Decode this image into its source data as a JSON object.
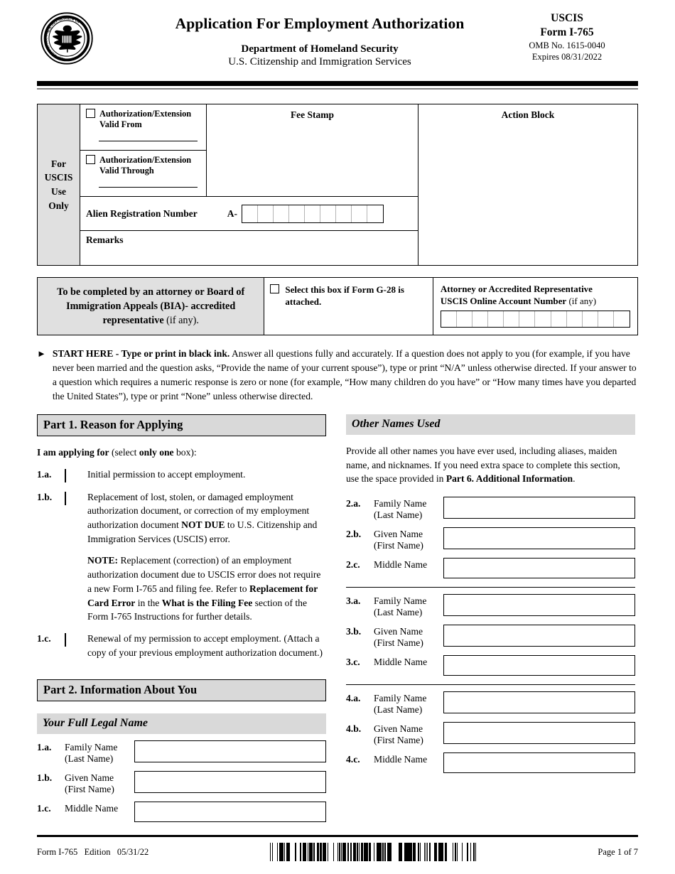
{
  "header": {
    "seal_icon": "dhs-seal-icon",
    "title": "Application For Employment Authorization",
    "department": "Department of Homeland Security",
    "agency": "U.S. Citizenship and Immigration Services",
    "agency_short": "USCIS",
    "form_number": "Form I-765",
    "omb": "OMB No. 1615-0040",
    "expires": "Expires 08/31/2022"
  },
  "uscis_use_only": {
    "side_label": "For\nUSCIS\nUse\nOnly",
    "valid_from_label": "Authorization/Extension\nValid From",
    "valid_through_label": "Authorization/Extension\nValid Through",
    "fee_stamp_label": "Fee Stamp",
    "action_block_label": "Action Block",
    "alien_registration_label": "Alien Registration Number",
    "alien_prefix": "A-",
    "alien_cells": 9,
    "remarks_label": "Remarks"
  },
  "attorney_block": {
    "description_bold": "To be completed by an attorney or Board of Immigration Appeals (BIA)- accredited representative",
    "description_thin": " (if any).",
    "g28_label": "Select this box if Form G-28 is attached.",
    "account_label_line1": "Attorney or Accredited Representative",
    "account_label_line2_bold": "USCIS Online Account Number",
    "account_label_line2_thin": " (if any)",
    "account_cells": 12
  },
  "start_here": {
    "arrow_icon": "triangle-right-icon",
    "bold_lead": "START HERE - Type or print in black ink.",
    "body": " Answer all questions fully and accurately.  If a question does not apply to you (for example, if you have never been married and the question asks, “Provide the name of your current spouse”), type or print “N/A” unless otherwise directed.  If your answer to a question which requires a numeric response is zero or none (for example, “How many children do you have” or “How many times have you departed the United States”), type or print “None” unless otherwise directed."
  },
  "part1": {
    "header": "Part 1.  Reason for Applying",
    "intro_bold": "I am applying for",
    "intro_mid": " (select ",
    "intro_bold2": "only one",
    "intro_end": " box):",
    "items": [
      {
        "num": "1.a.",
        "text": "Initial permission to accept employment."
      },
      {
        "num": "1.b.",
        "text_part1": "Replacement of lost, stolen, or damaged employment authorization document, or correction of my employment authorization document ",
        "bold1": "NOT DUE",
        "text_part2": " to U.S. Citizenship and Immigration Services (USCIS) error."
      },
      {
        "num": "1.c.",
        "text": "Renewal of my permission to accept employment. (Attach a copy of your previous employment authorization document.)"
      }
    ],
    "note": {
      "label": "NOTE:",
      "part1": "  Replacement (correction) of an employment authorization document due to USCIS error does not require a new Form I-765 and filing fee.  Refer to ",
      "bold1": "Replacement for Card Error",
      "part2": " in the ",
      "bold2": "What is the Filing Fee",
      "part3": " section of the Form I-765 Instructions for further details."
    }
  },
  "part2": {
    "header": "Part 2.  Information About You",
    "full_legal_name_header": "Your Full Legal Name",
    "fields": [
      {
        "num": "1.a.",
        "label": "Family Name\n(Last Name)",
        "value": ""
      },
      {
        "num": "1.b.",
        "label": "Given Name\n(First Name)",
        "value": ""
      },
      {
        "num": "1.c.",
        "label": "Middle Name",
        "value": ""
      }
    ]
  },
  "other_names": {
    "header": "Other Names Used",
    "description_part1": "Provide all other names you have ever used, including aliases, maiden name, and nicknames.  If you need extra space to complete this section, use the space provided in ",
    "description_bold": "Part 6. Additional Information",
    "description_part2": ".",
    "groups": [
      {
        "fields": [
          {
            "num": "2.a.",
            "label": "Family Name\n(Last Name)",
            "value": ""
          },
          {
            "num": "2.b.",
            "label": "Given Name\n(First Name)",
            "value": ""
          },
          {
            "num": "2.c.",
            "label": "Middle Name",
            "value": ""
          }
        ]
      },
      {
        "fields": [
          {
            "num": "3.a.",
            "label": "Family Name\n(Last Name)",
            "value": ""
          },
          {
            "num": "3.b.",
            "label": "Given Name\n(First Name)",
            "value": ""
          },
          {
            "num": "3.c.",
            "label": "Middle Name",
            "value": ""
          }
        ]
      },
      {
        "fields": [
          {
            "num": "4.a.",
            "label": "Family Name\n(Last Name)",
            "value": ""
          },
          {
            "num": "4.b.",
            "label": "Given Name\n(First Name)",
            "value": ""
          },
          {
            "num": "4.c.",
            "label": "Middle Name",
            "value": ""
          }
        ]
      }
    ]
  },
  "footer": {
    "form_edition": "Form I-765   Edition   05/31/22",
    "barcode_icon": "barcode-icon",
    "page": "Page 1 of 7"
  },
  "colors": {
    "shade_gray": "#d9d9d9",
    "box_gray": "#e0e0e0",
    "rule_black": "#000000",
    "rule_gray": "#808080"
  }
}
